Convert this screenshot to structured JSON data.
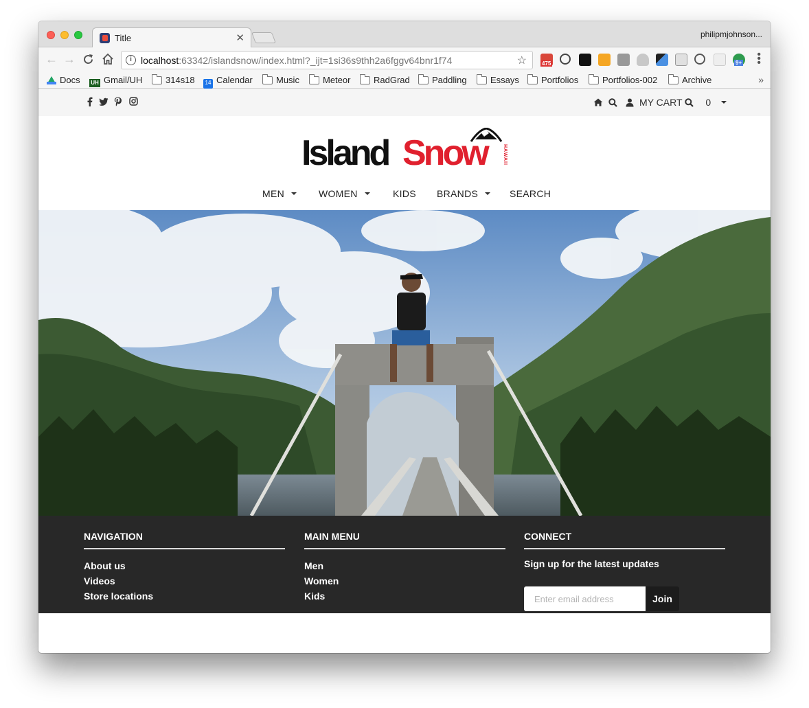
{
  "browser": {
    "tab_title": "Title",
    "tab_close": "✕",
    "profile": "philipmjohnson...",
    "url_host": "localhost",
    "url_rest": ":63342/islandsnow/index.html?_ijt=1si36s9thh2a6fggv64bnr1f74",
    "ext_badge": "475",
    "ext_badge2": "9+",
    "bookmarks": [
      "Docs",
      "Gmail/UH",
      "314s18",
      "Calendar",
      "Music",
      "Meteor",
      "RadGrad",
      "Paddling",
      "Essays",
      "Portfolios",
      "Portfolios-002",
      "Archive"
    ],
    "uh_icon_text": "UH",
    "calendar_icon_text": "14",
    "more_bookmarks": "»"
  },
  "site": {
    "topbar": {
      "cart_label": "MY CART",
      "cart_count": "0"
    },
    "logo": {
      "word1": "Island",
      "word2": "Snow",
      "tag": "HAWAII"
    },
    "nav": [
      {
        "label": "MEN",
        "dropdown": true
      },
      {
        "label": "WOMEN",
        "dropdown": true
      },
      {
        "label": "KIDS",
        "dropdown": false
      },
      {
        "label": "BRANDS",
        "dropdown": true
      },
      {
        "label": "SEARCH",
        "dropdown": false
      }
    ],
    "footer": {
      "navigation": {
        "heading": "NAVIGATION",
        "links": [
          "About us",
          "Videos",
          "Store locations"
        ]
      },
      "main_menu": {
        "heading": "MAIN MENU",
        "links": [
          "Men",
          "Women",
          "Kids"
        ]
      },
      "connect": {
        "heading": "CONNECT",
        "signup_text": "Sign up for the latest updates",
        "email_placeholder": "Enter email address",
        "join_label": "Join"
      }
    }
  },
  "colors": {
    "brand_red": "#e0202e",
    "footer_bg": "#282828",
    "topbar_bg": "#f5f5f5"
  },
  "icons": [
    "facebook-icon",
    "twitter-icon",
    "pinterest-icon",
    "instagram-icon",
    "home-icon",
    "search-icon",
    "user-icon",
    "caret-down-icon"
  ]
}
